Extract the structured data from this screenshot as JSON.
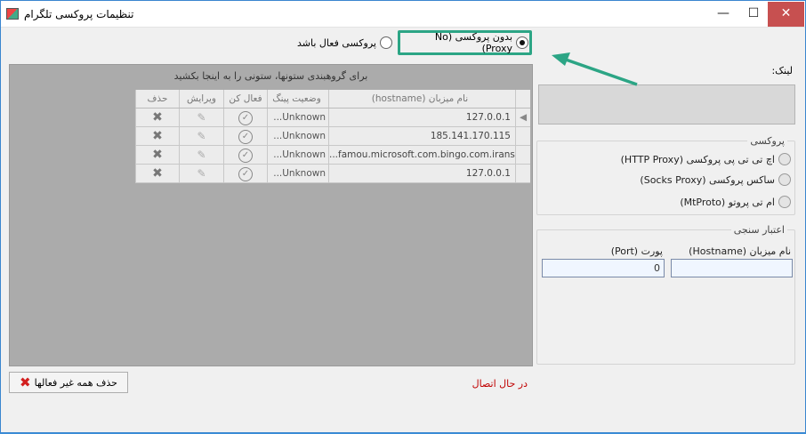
{
  "window": {
    "title": "تنظیمات پروکسی تلگرام",
    "minimize_label": "—",
    "maximize_label": "☐",
    "close_label": "✕"
  },
  "top_options": {
    "no_proxy_label": "بدون پروکسی (No Proxy)",
    "no_proxy_selected": true,
    "proxy_active_label": "پروکسی فعال باشد",
    "proxy_active_selected": false
  },
  "grid": {
    "group_hint": "برای گروهبندی ستونها، ستونی را به اینجا بکشید",
    "columns": {
      "delete": "حذف",
      "edit": "ویرایش",
      "activate": "فعال کن",
      "ping": "وضعیت پینگ",
      "hostname": "نام میزبان (hostname)"
    },
    "rows": [
      {
        "hostname": "127.0.0.1",
        "ping": "...Unknown",
        "current": true
      },
      {
        "hostname": "185.141.170.115",
        "ping": "...Unknown",
        "current": false
      },
      {
        "hostname": "...famou.microsoft.com.bingo.com.iranse",
        "ping": "...Unknown",
        "current": false
      },
      {
        "hostname": "127.0.0.1",
        "ping": "...Unknown",
        "current": false
      }
    ]
  },
  "buttons": {
    "delete_inactive_label": "حذف همه غیر فعالها"
  },
  "status": {
    "connecting_text": "در حال اتصال",
    "color": "#c00000"
  },
  "link": {
    "label": "لینک:"
  },
  "proxy_group": {
    "title": "پروکسی",
    "options": [
      {
        "label": "اچ تی تی پی پروکسی (HTTP Proxy)"
      },
      {
        "label": "ساکس پروکسی (Socks Proxy)"
      },
      {
        "label": "ام تی پروتو (MtProto)"
      }
    ]
  },
  "auth_group": {
    "title": "اعتبار سنجی",
    "hostname_label": "نام میزبان (Hostname)",
    "port_label": "پورت (Port)",
    "hostname_value": "",
    "port_value": "0"
  },
  "icons": {
    "delete": "x-icon",
    "edit": "pencil-icon",
    "activate": "check-circle-icon",
    "annotation_arrow_color": "#2ca585"
  }
}
